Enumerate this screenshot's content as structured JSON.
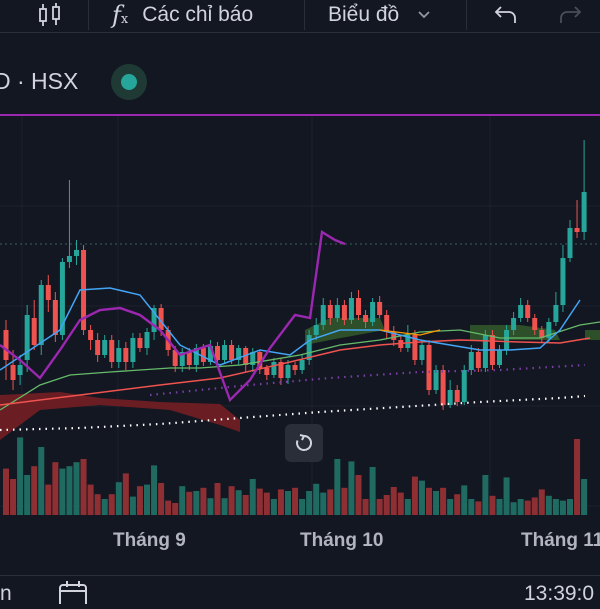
{
  "toolbar": {
    "indicators_label": "Các chỉ báo",
    "chart_label": "Biểu đồ"
  },
  "symbol": {
    "text": "D · HSX",
    "status_color": "#26a69a"
  },
  "icons": {
    "candles": "candles-icon",
    "fx": "fx-icon",
    "chevron": "chevron-down-icon",
    "undo": "undo-icon",
    "redo": "redo-icon",
    "reset": "reset-icon",
    "calendar": "calendar-icon"
  },
  "colors": {
    "bg": "#131722",
    "up": "#26a69a",
    "down": "#ef5350",
    "accent_purple": "#9c27b0",
    "ma_blue": "#42a5f5",
    "ma_green": "#66bb6a",
    "ma_red": "#ef5350",
    "ma_orange": "#ff9800"
  },
  "xaxis": {
    "labels": [
      "Tháng 9",
      "Tháng 10",
      "Tháng 11"
    ]
  },
  "bottom": {
    "left_text": "n",
    "time_text": "13:39:0"
  },
  "chart_data": {
    "type": "candlestick",
    "candles": [
      [
        330,
        360,
        380,
        320
      ],
      [
        365,
        380,
        390,
        350
      ],
      [
        375,
        365,
        385,
        355
      ],
      [
        360,
        315,
        372,
        305
      ],
      [
        318,
        345,
        350,
        300
      ],
      [
        345,
        285,
        355,
        280
      ],
      [
        285,
        300,
        312,
        275
      ],
      [
        300,
        335,
        342,
        292
      ],
      [
        335,
        262,
        340,
        258
      ],
      [
        262,
        256,
        268,
        180
      ],
      [
        256,
        250,
        265,
        240
      ],
      [
        250,
        330,
        335,
        245
      ],
      [
        330,
        340,
        350,
        325
      ],
      [
        340,
        355,
        362,
        333
      ],
      [
        355,
        340,
        358,
        335
      ],
      [
        340,
        362,
        368,
        335
      ],
      [
        362,
        348,
        368,
        340
      ],
      [
        348,
        362,
        370,
        342
      ],
      [
        362,
        338,
        368,
        333
      ],
      [
        338,
        348,
        352,
        333
      ],
      [
        348,
        332,
        355,
        328
      ],
      [
        332,
        308,
        340,
        305
      ],
      [
        308,
        330,
        336,
        304
      ],
      [
        330,
        350,
        356,
        326
      ],
      [
        350,
        366,
        372,
        346
      ],
      [
        366,
        352,
        372,
        348
      ],
      [
        352,
        365,
        370,
        348
      ],
      [
        365,
        348,
        372,
        344
      ],
      [
        348,
        362,
        366,
        344
      ],
      [
        362,
        346,
        365,
        340
      ],
      [
        346,
        360,
        366,
        342
      ],
      [
        360,
        345,
        364,
        340
      ],
      [
        345,
        360,
        364,
        340
      ],
      [
        360,
        348,
        365,
        345
      ],
      [
        348,
        365,
        372,
        346
      ],
      [
        365,
        352,
        372,
        348
      ],
      [
        352,
        368,
        374,
        350
      ],
      [
        368,
        375,
        380,
        365
      ],
      [
        375,
        362,
        378,
        358
      ],
      [
        362,
        378,
        385,
        358
      ],
      [
        378,
        365,
        384,
        360
      ],
      [
        365,
        370,
        375,
        362
      ],
      [
        370,
        360,
        374,
        355
      ],
      [
        360,
        335,
        365,
        330
      ],
      [
        335,
        325,
        340,
        318
      ],
      [
        325,
        305,
        330,
        298
      ],
      [
        305,
        318,
        325,
        300
      ],
      [
        318,
        305,
        322,
        298
      ],
      [
        305,
        320,
        325,
        300
      ],
      [
        320,
        298,
        324,
        292
      ],
      [
        298,
        315,
        320,
        290
      ],
      [
        315,
        322,
        328,
        310
      ],
      [
        322,
        302,
        326,
        298
      ],
      [
        302,
        315,
        318,
        296
      ],
      [
        315,
        332,
        338,
        310
      ],
      [
        332,
        340,
        346,
        326
      ],
      [
        340,
        348,
        352,
        335
      ],
      [
        348,
        335,
        352,
        325
      ],
      [
        335,
        360,
        365,
        330
      ],
      [
        360,
        345,
        365,
        340
      ],
      [
        345,
        390,
        395,
        340
      ],
      [
        390,
        370,
        394,
        365
      ],
      [
        370,
        405,
        410,
        365
      ],
      [
        405,
        390,
        408,
        380
      ],
      [
        390,
        402,
        406,
        385
      ],
      [
        402,
        370,
        405,
        365
      ],
      [
        370,
        352,
        375,
        345
      ],
      [
        352,
        368,
        372,
        348
      ],
      [
        368,
        335,
        372,
        330
      ],
      [
        335,
        365,
        370,
        330
      ],
      [
        365,
        350,
        368,
        345
      ],
      [
        350,
        330,
        355,
        325
      ],
      [
        330,
        318,
        335,
        312
      ],
      [
        318,
        305,
        322,
        298
      ],
      [
        305,
        318,
        322,
        300
      ],
      [
        318,
        330,
        335,
        314
      ],
      [
        330,
        338,
        342,
        326
      ],
      [
        338,
        322,
        342,
        318
      ],
      [
        322,
        305,
        326,
        292
      ],
      [
        305,
        258,
        312,
        245
      ],
      [
        258,
        228,
        262,
        220
      ],
      [
        228,
        232,
        238,
        200
      ],
      [
        232,
        192,
        240,
        140
      ]
    ],
    "volumes": [
      0.58,
      0.45,
      0.97,
      0.5,
      0.61,
      0.85,
      0.38,
      0.66,
      0.58,
      0.61,
      0.66,
      0.7,
      0.38,
      0.26,
      0.2,
      0.26,
      0.41,
      0.52,
      0.23,
      0.36,
      0.38,
      0.62,
      0.4,
      0.18,
      0.15,
      0.36,
      0.29,
      0.3,
      0.34,
      0.21,
      0.4,
      0.21,
      0.36,
      0.31,
      0.25,
      0.45,
      0.33,
      0.28,
      0.2,
      0.32,
      0.3,
      0.34,
      0.2,
      0.3,
      0.39,
      0.28,
      0.32,
      0.7,
      0.34,
      0.67,
      0.5,
      0.2,
      0.6,
      0.2,
      0.25,
      0.35,
      0.28,
      0.2,
      0.48,
      0.43,
      0.34,
      0.3,
      0.34,
      0.2,
      0.26,
      0.37,
      0.2,
      0.17,
      0.5,
      0.24,
      0.2,
      0.47,
      0.16,
      0.2,
      0.18,
      0.22,
      0.32,
      0.24,
      0.2,
      0.18,
      0.2,
      0.95,
      0.45
    ]
  }
}
